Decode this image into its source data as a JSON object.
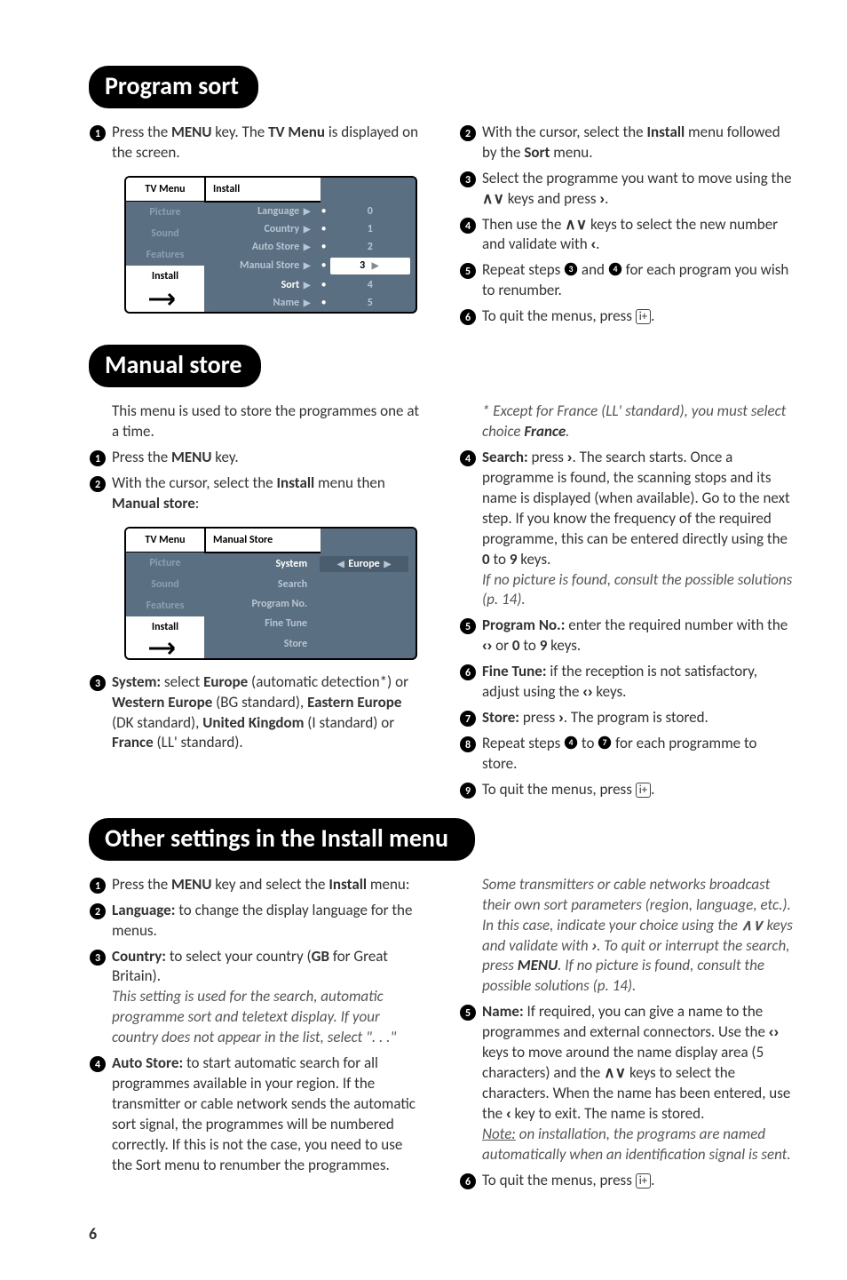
{
  "page_number": "6",
  "sections": {
    "program_sort": {
      "title": "Program sort",
      "left_step1_a": "Press the ",
      "left_step1_b": "MENU",
      "left_step1_c": " key. The ",
      "left_step1_d": "TV Menu",
      "left_step1_e": " is displayed on the screen.",
      "right_step2_a": "With the cursor, select the ",
      "right_step2_b": "Install",
      "right_step2_c": " menu followed by the ",
      "right_step2_d": "Sort",
      "right_step2_e": " menu.",
      "right_step3_a": "Select the programme you want to move using the ",
      "right_step3_b": " keys and press ",
      "right_step3_c": ".",
      "right_step4_a": "Then use the ",
      "right_step4_b": " keys to select the new number and validate with ",
      "right_step4_c": ".",
      "right_step5_a": "Repeat steps ",
      "right_step5_b": " and ",
      "right_step5_c": " for each program you wish to renumber.",
      "right_step6_a": "To quit the menus, press ",
      "right_step6_b": "."
    },
    "manual_store": {
      "title": "Manual store",
      "left_intro": "This menu is used to store the programmes one at a time.",
      "left_step1_a": "Press the ",
      "left_step1_b": "MENU",
      "left_step1_c": " key.",
      "left_step2_a": "With the cursor, select the ",
      "left_step2_b": "Install",
      "left_step2_c": " menu then ",
      "left_step2_d": "Manual store",
      "left_step2_e": ":",
      "left_step3_a": "System:",
      "left_step3_b": " select ",
      "left_step3_c": "Europe",
      "left_step3_d": " (automatic detection*) or ",
      "left_step3_e": "Western Europe",
      "left_step3_f": " (BG standard), ",
      "left_step3_g": "Eastern Europe",
      "left_step3_h": " (DK standard), ",
      "left_step3_i": "United Kingdom",
      "left_step3_j": " (I standard) or ",
      "left_step3_k": "France",
      "left_step3_l": " (LL' standard).",
      "right_note_a": "* Except for France (LL' standard), you must select choice ",
      "right_note_b": "France",
      "right_note_c": ".",
      "right_step4_a": "Search:",
      "right_step4_b": " press ",
      "right_step4_c": ". The search starts. Once a programme is found, the scanning stops and its name is displayed (when available). Go to the next step. If you know the frequency of the required programme, this can be entered directly using the ",
      "right_step4_d": "0",
      "right_step4_e": " to ",
      "right_step4_f": "9",
      "right_step4_g": " keys.",
      "right_step4_note": "If no picture is found, consult the possible solutions (p. 14).",
      "right_step5_a": "Program No.:",
      "right_step5_b": " enter the required number with the ",
      "right_step5_c": " or ",
      "right_step5_d": "0",
      "right_step5_e": " to ",
      "right_step5_f": "9",
      "right_step5_g": " keys.",
      "right_step6_a": "Fine Tune:",
      "right_step6_b": " if the reception is not satisfactory, adjust using the ",
      "right_step6_c": " keys.",
      "right_step7_a": "Store:",
      "right_step7_b": " press ",
      "right_step7_c": ". The program is stored.",
      "right_step8_a": "Repeat steps ",
      "right_step8_b": " to ",
      "right_step8_c": " for each programme to store.",
      "right_step9_a": "To quit the menus, press ",
      "right_step9_b": "."
    },
    "other_settings": {
      "title": "Other settings in the Install menu",
      "left_step1_a": "Press the ",
      "left_step1_b": "MENU",
      "left_step1_c": " key and select the ",
      "left_step1_d": "Install",
      "left_step1_e": " menu:",
      "left_step2_a": "Language:",
      "left_step2_b": " to change the display language for the menus.",
      "left_step3_a": "Country:",
      "left_step3_b": " to select your country (",
      "left_step3_c": "GB",
      "left_step3_d": " for Great Britain).",
      "left_step3_note": "This setting is used for the search, automatic programme sort and teletext display. If your country does not appear in the list, select \". . .\"",
      "left_step4_a": "Auto Store:",
      "left_step4_b": " to start automatic search for all programmes available in your region. If the transmitter or cable network sends the automatic sort signal, the programmes will be numbered correctly. If this is not the case, you need to use the Sort menu to renumber the programmes.",
      "right_note_a": "Some transmitters or cable networks broadcast their own sort parameters (region, language, etc.). In this case, indicate your choice using the ",
      "right_note_b": " keys and validate with ",
      "right_note_c": ". To quit or interrupt the search, press ",
      "right_note_d": "MENU",
      "right_note_e": ". If no picture is found, consult the possible solutions (p. 14).",
      "right_step5_a": "Name:",
      "right_step5_b": " If required, you can give a name to the programmes and external connectors. Use the ",
      "right_step5_c": " keys to move around the name display area (5 characters) and the ",
      "right_step5_d": " keys to select the characters. When the name has been entered, use the ",
      "right_step5_e": " key to exit. The name is stored.",
      "right_step5_note_a": "Note:",
      "right_step5_note_b": " on installation, the programs are named automatically when an identification signal is sent.",
      "right_step6_a": "To quit the menus, press ",
      "right_step6_b": "."
    }
  },
  "glyphs": {
    "up_down": "∧∨",
    "left_right": "‹›",
    "right": "›",
    "left": "‹",
    "info_key": "i+"
  },
  "menushot1": {
    "left_header": "TV Menu",
    "left_items": [
      "Picture",
      "Sound",
      "Features",
      "Install"
    ],
    "left_active_index": 3,
    "right_header": "Install",
    "rows": [
      {
        "label": "Language",
        "val": "0"
      },
      {
        "label": "Country",
        "val": "1"
      },
      {
        "label": "Auto Store",
        "val": "2"
      },
      {
        "label": "Manual Store",
        "val": "3",
        "selected": true
      },
      {
        "label": "Sort",
        "val": "4",
        "strong": true
      },
      {
        "label": "Name",
        "val": "5"
      }
    ]
  },
  "menushot2": {
    "left_header": "TV Menu",
    "left_items": [
      "Picture",
      "Sound",
      "Features",
      "Install"
    ],
    "left_active_index": 3,
    "right_header": "Manual Store",
    "rows": [
      {
        "label": "System",
        "val": "Europe",
        "strong": true,
        "selected": true
      },
      {
        "label": "Search"
      },
      {
        "label": "Program No."
      },
      {
        "label": "Fine Tune"
      },
      {
        "label": "Store"
      }
    ]
  }
}
